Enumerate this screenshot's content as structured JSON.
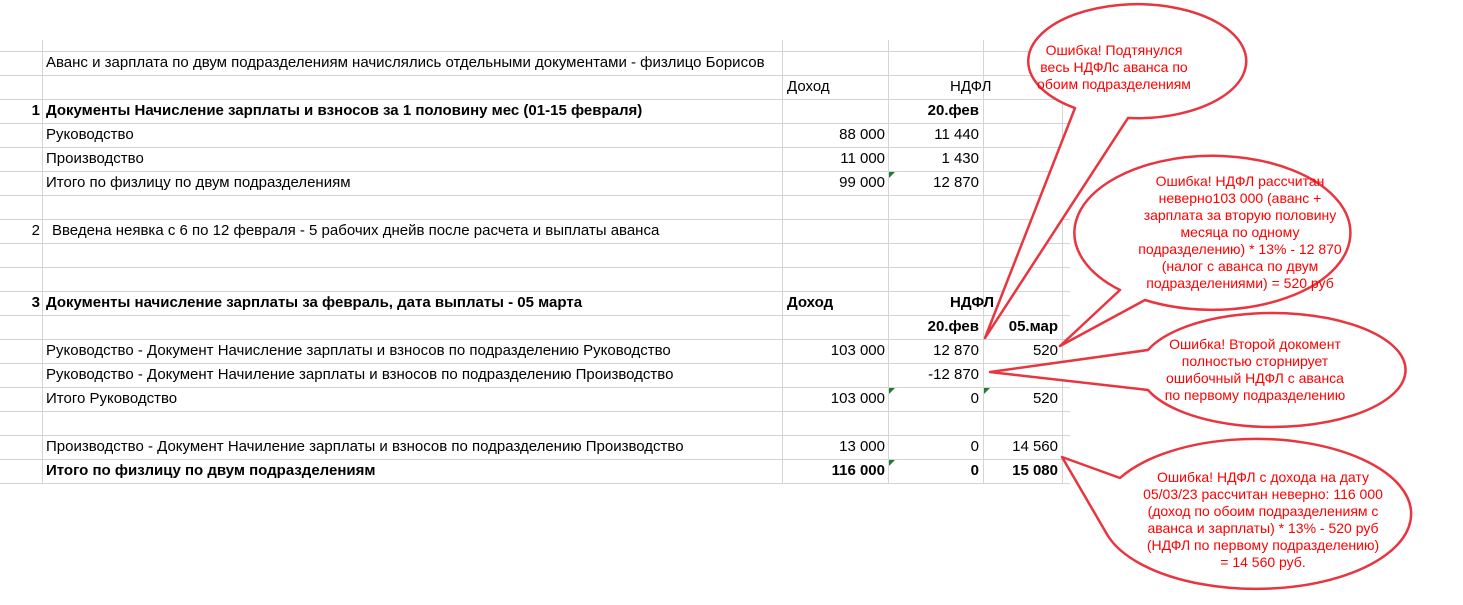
{
  "title": "Аванс и зарплата по двум подразделениям начислялись отдельными документами - физлицо Борисов",
  "header1": {
    "income": "Доход",
    "ndfl": "НДФЛ"
  },
  "section1": {
    "num": "1",
    "title": "Документы Начисление зарплаты и взносов за 1 половину мес (01-15 февраля)",
    "date": "20.фев",
    "rows": [
      {
        "label": "Руководство",
        "income": "88 000",
        "ndfl": "11 440"
      },
      {
        "label": "Производство",
        "income": "11 000",
        "ndfl": "1 430"
      },
      {
        "label": "Итого по физлицу по двум подразделениям",
        "income": "99 000",
        "ndfl": "12 870"
      }
    ]
  },
  "section2": {
    "num": "2",
    "text": "Введена неявка  с 6 по 12 февраля - 5 рабочих днейв после расчета  и  выплаты аванса"
  },
  "section3": {
    "num": "3",
    "title": "Документы начисление зарплаты за февраль, дата выплаты - 05 марта",
    "income_header": "Доход",
    "ndfl_header": "НДФЛ",
    "date1": "20.фев",
    "date2": "05.мар",
    "rows": [
      {
        "label": "Руководство -   Документ Начисление зарплаты  и взносов по подразделению Руководство",
        "income": "103 000",
        "ndfl1": "12 870",
        "ndfl2": "520"
      },
      {
        "label": "Руководство -   Документ Начиление зарплаты и взносов  по подразделению Производство",
        "income": "",
        "ndfl1": "-12 870",
        "ndfl2": ""
      },
      {
        "label": "Итого Руководство",
        "income": "103 000",
        "ndfl1": "0",
        "ndfl2": "520"
      },
      {
        "label": "Производство -  Документ Начиление зарплаты и взносов  по подразделению Производство",
        "income": "13 000",
        "ndfl1": "0",
        "ndfl2": "14 560"
      }
    ],
    "total": {
      "label": "Итого по физлицу по двум подразделениям",
      "income": "116 000",
      "ndfl1": "0",
      "ndfl2": "15 080"
    }
  },
  "callouts": [
    {
      "lines": [
        "Ошибка! Подтянулся",
        "весь НДФЛс аванса  по",
        "обоим подразделениям"
      ]
    },
    {
      "lines": [
        "Ошибка! НДФЛ рассчитан",
        "неверно103 000 (аванс +",
        "зарплата за вторую половину",
        "месяца по одному",
        "подразделению) * 13% - 12 870",
        "(налог с аванса по двум",
        "подразделениями) = 520 руб"
      ]
    },
    {
      "lines": [
        "Ошибка! Второй докомент",
        "полностью сторнирует",
        "ошибочный НДФЛ с аванса",
        "по первому подразделению"
      ]
    },
    {
      "lines": [
        "Ошибка! НДФЛ с дохода на дату",
        "05/03/23 рассчитан неверно: 116 000",
        "(доход по обоим подразделениям с",
        "аванса и зарплаты) * 13% - 520 руб",
        "(НДФЛ по первому подразделению)",
        "= 14 560 руб."
      ]
    }
  ],
  "colors": {
    "callout_border": "#e8353f",
    "callout_text": "#ff0000",
    "grid": "#d4d4d4",
    "error_marker": "#1e7b34"
  }
}
